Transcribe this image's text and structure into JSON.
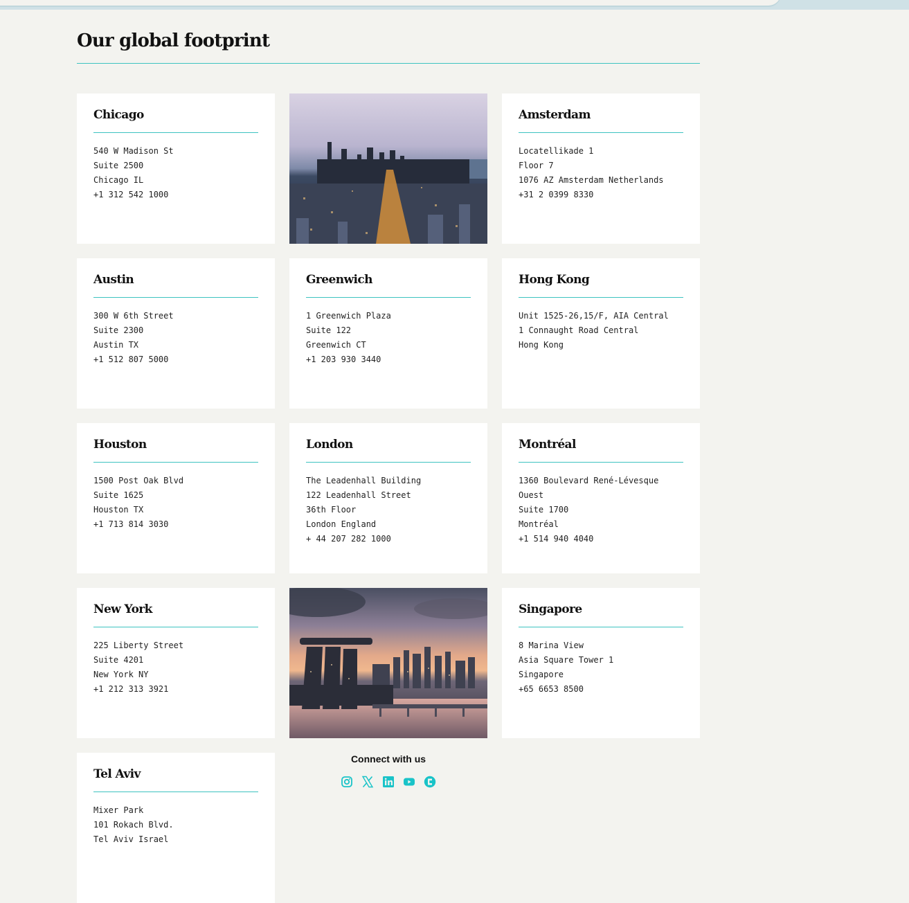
{
  "section": {
    "title": "Our global footprint"
  },
  "offices": [
    {
      "city": "Chicago",
      "lines": [
        "540 W Madison St",
        "Suite 2500",
        "Chicago IL",
        "+1 312 542 1000"
      ]
    },
    {
      "city": "Amsterdam",
      "lines": [
        "Locatellikade 1",
        "Floor 7",
        "1076 AZ Amsterdam Netherlands",
        "+31 2 0399 8330"
      ]
    },
    {
      "city": "Austin",
      "lines": [
        "300 W 6th Street",
        "Suite 2300",
        "Austin TX",
        "+1 512 807 5000"
      ]
    },
    {
      "city": "Greenwich",
      "lines": [
        "1 Greenwich Plaza",
        "Suite 122",
        "Greenwich CT",
        "+1 203 930 3440"
      ]
    },
    {
      "city": "Hong Kong",
      "lines": [
        "Unit 1525-26,15/F, AIA Central",
        "1 Connaught Road Central",
        "Hong Kong"
      ]
    },
    {
      "city": "Houston",
      "lines": [
        "1500 Post Oak Blvd",
        "Suite 1625",
        "Houston TX",
        "+1 713 814 3030"
      ]
    },
    {
      "city": "London",
      "lines": [
        "The Leadenhall Building",
        "122 Leadenhall Street",
        "36th Floor",
        "London England",
        "+ 44 207 282 1000"
      ]
    },
    {
      "city": "Montréal",
      "lines": [
        "1360 Boulevard René-Lévesque",
        "Ouest",
        "Suite 1700",
        "Montréal",
        "+1 514 940 4040"
      ]
    },
    {
      "city": "New York",
      "lines": [
        "225 Liberty Street",
        "Suite 4201",
        "New York NY",
        "+1 212 313 3921"
      ]
    },
    {
      "city": "Singapore",
      "lines": [
        "8 Marina View",
        "Asia Square Tower 1",
        "Singapore",
        "+65 6653 8500"
      ]
    },
    {
      "city": "Tel Aviv",
      "lines": [
        "Mixer Park",
        "101 Rokach Blvd.",
        "Tel Aviv Israel"
      ]
    }
  ],
  "connect": {
    "title": "Connect with us",
    "icons": [
      "instagram-icon",
      "x-icon",
      "linkedin-icon",
      "youtube-icon",
      "glassdoor-icon"
    ]
  },
  "colors": {
    "accent": "#3cc2c0",
    "background": "#f3f3ef",
    "card": "#ffffff",
    "icon": "#19c3c8"
  }
}
